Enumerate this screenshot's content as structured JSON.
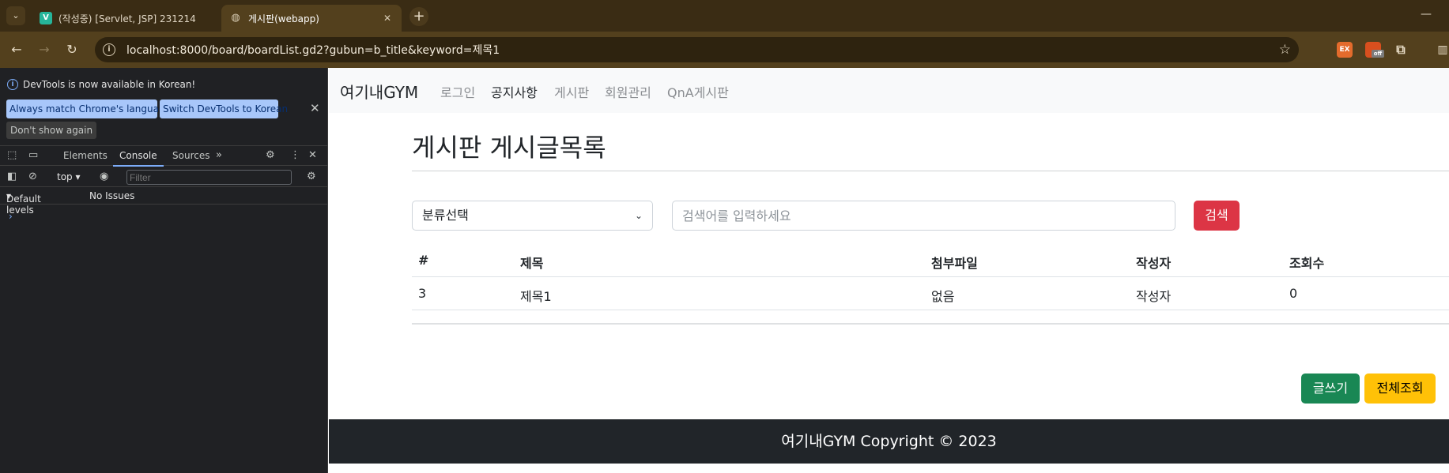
{
  "browser": {
    "tabs": [
      {
        "title": "(작성중) [Servlet, JSP] 231214",
        "favicon": "V",
        "active": false
      },
      {
        "title": "게시판(webapp)",
        "favicon": "globe-icon",
        "active": true
      }
    ],
    "url": "localhost:8000/board/boardList.gd2?gubun=b_title&keyword=제목1",
    "extensions": {
      "ext1": "EX",
      "ext2_badge": "off"
    }
  },
  "devtools": {
    "banner": "DevTools is now available in Korean!",
    "buttons": {
      "always_match": "Always match Chrome's language",
      "switch": "Switch DevTools to Korean",
      "dont_show": "Don't show again"
    },
    "tabs": [
      "Elements",
      "Console",
      "Sources"
    ],
    "active_tab": "Console",
    "context": "top",
    "filter_placeholder": "Filter",
    "levels": "Default levels",
    "issues": "No Issues"
  },
  "page": {
    "brand": "여기내GYM",
    "nav": [
      {
        "label": "로그인",
        "active": false
      },
      {
        "label": "공지사항",
        "active": true
      },
      {
        "label": "게시판",
        "active": false
      },
      {
        "label": "회원관리",
        "active": false
      },
      {
        "label": "QnA게시판",
        "active": false
      }
    ],
    "heading": "게시판 게시글목록",
    "search": {
      "select_value": "분류선택",
      "placeholder": "검색어를 입력하세요",
      "button": "검색"
    },
    "table": {
      "headers": [
        "#",
        "제목",
        "첨부파일",
        "작성자",
        "조회수"
      ],
      "rows": [
        [
          "3",
          "제목1",
          "없음",
          "작성자",
          "0"
        ]
      ]
    },
    "actions": {
      "write": "글쓰기",
      "view_all": "전체조회"
    },
    "footer": "여기내GYM Copyright © 2023"
  },
  "colors": {
    "danger": "#dc3545",
    "success": "#198754",
    "warning": "#ffc107",
    "footer_bg": "#212529",
    "chrome_bg": "#3a2c14"
  }
}
